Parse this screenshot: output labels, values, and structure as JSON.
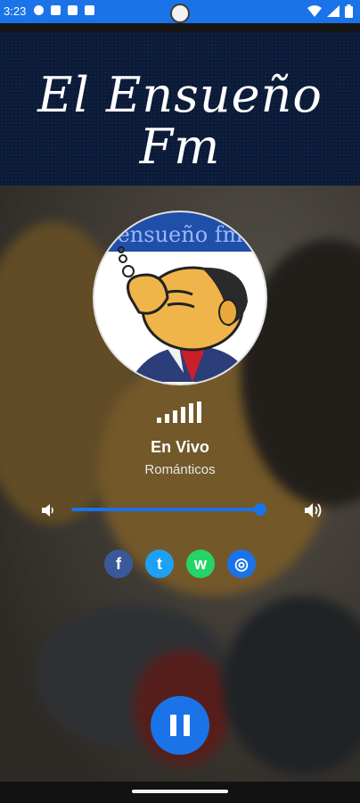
{
  "status_bar": {
    "time": "3:23"
  },
  "header": {
    "title_line1": "El Ensueño",
    "title_line2": "Fm"
  },
  "album_art": {
    "band_text": "ensueño fm"
  },
  "now_playing": {
    "live_label": "En Vivo",
    "genre": "Románticos"
  },
  "volume": {
    "level": 0.93
  },
  "social": [
    {
      "name": "facebook",
      "glyph": "f",
      "color": "#3b5998"
    },
    {
      "name": "twitter",
      "glyph": "t",
      "color": "#1da1f2"
    },
    {
      "name": "whatsapp",
      "glyph": "w",
      "color": "#25d366"
    },
    {
      "name": "website",
      "glyph": "◎",
      "color": "#1a73e8"
    }
  ],
  "player": {
    "state": "playing",
    "accent": "#1a73e8"
  }
}
